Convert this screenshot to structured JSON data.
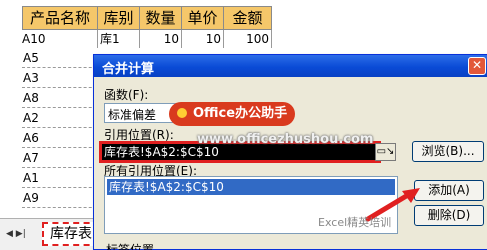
{
  "spreadsheet": {
    "headers": [
      "产品名称",
      "库别",
      "数量",
      "单价",
      "金额"
    ],
    "first_row": [
      "A10",
      "库1",
      "10",
      "10",
      "100"
    ],
    "rows": [
      "A5",
      "A3",
      "A8",
      "A2",
      "A6",
      "A7",
      "A1",
      "A9"
    ],
    "sheet_tab": "库存表"
  },
  "dialog": {
    "title": "合并计算",
    "close_glyph": "✕",
    "function_label": "函数(F):",
    "function_value": "标准偏差",
    "reference_label": "引用位置(R):",
    "reference_value": "库存表!$A$2:$C$10",
    "browse_label": "浏览(B)...",
    "all_references_label": "所有引用位置(E):",
    "all_references": [
      "库存表!$A$2:$C$10"
    ],
    "add_label": "添加(A)",
    "delete_label": "删除(D)",
    "label_position_label": "标签位置"
  },
  "overlays": {
    "banner_text": "Office办公助手",
    "watermark_url": "www.officezhushou.com",
    "channel_text": "Excel精英培训"
  },
  "icons": {
    "close": "close-icon",
    "dropdown": "chevron-down-icon",
    "collapse": "collapse-dialog-icon",
    "arrow": "red-arrow-icon"
  },
  "colors": {
    "header_fill": "#f5c76a",
    "title_bar": "#0a4bd6",
    "highlight_red": "#e02020",
    "banner_red": "#d93a1e",
    "selection_blue": "#316ac5"
  }
}
